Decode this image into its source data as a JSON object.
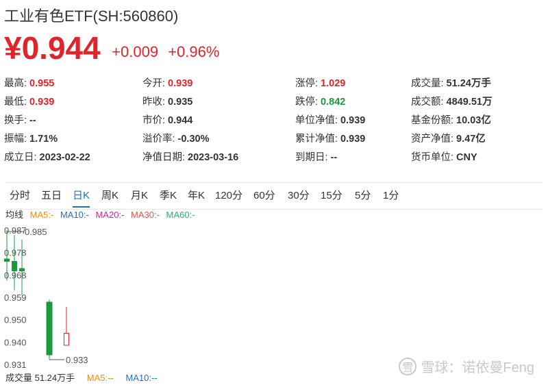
{
  "header": {
    "title": "工业有色ETF(SH:560860)",
    "price": "¥0.944",
    "change": "+0.009",
    "change_pct": "+0.96%"
  },
  "quote": {
    "rows": [
      [
        {
          "label": "最高:",
          "value": "0.955",
          "tone": "up"
        },
        {
          "label": "今开:",
          "value": "0.939",
          "tone": "up"
        },
        {
          "label": "涨停:",
          "value": "1.029",
          "tone": "up"
        },
        {
          "label": "成交量:",
          "value": "51.24万手",
          "tone": ""
        }
      ],
      [
        {
          "label": "最低:",
          "value": "0.939",
          "tone": "up"
        },
        {
          "label": "昨收:",
          "value": "0.935",
          "tone": ""
        },
        {
          "label": "跌停:",
          "value": "0.842",
          "tone": "down"
        },
        {
          "label": "成交额:",
          "value": "4849.51万",
          "tone": ""
        }
      ],
      [
        {
          "label": "换手:",
          "value": "--",
          "tone": ""
        },
        {
          "label": "市价:",
          "value": "0.944",
          "tone": ""
        },
        {
          "label": "单位净值:",
          "value": "0.939",
          "tone": ""
        },
        {
          "label": "基金份额:",
          "value": "10.03亿",
          "tone": ""
        }
      ],
      [
        {
          "label": "振幅:",
          "value": "1.71%",
          "tone": ""
        },
        {
          "label": "溢价率:",
          "value": "-0.30%",
          "tone": ""
        },
        {
          "label": "累计净值:",
          "value": "0.939",
          "tone": ""
        },
        {
          "label": "资产净值:",
          "value": "9.47亿",
          "tone": ""
        }
      ],
      [
        {
          "label": "成立日:",
          "value": "2023-02-22",
          "tone": ""
        },
        {
          "label": "净值日期:",
          "value": "2023-03-16",
          "tone": ""
        },
        {
          "label": "到期日:",
          "value": "--",
          "tone": ""
        },
        {
          "label": "货币单位:",
          "value": "CNY",
          "tone": ""
        }
      ]
    ]
  },
  "tabs": [
    {
      "label": "分时",
      "active": false
    },
    {
      "label": "五日",
      "active": false
    },
    {
      "label": "日K",
      "active": true
    },
    {
      "label": "周K",
      "active": false
    },
    {
      "label": "月K",
      "active": false
    },
    {
      "label": "季K",
      "active": false
    },
    {
      "label": "年K",
      "active": false
    },
    {
      "label": "120分",
      "active": false
    },
    {
      "label": "60分",
      "active": false
    },
    {
      "label": "30分",
      "active": false
    },
    {
      "label": "15分",
      "active": false
    },
    {
      "label": "5分",
      "active": false
    },
    {
      "label": "1分",
      "active": false
    }
  ],
  "ma_line": {
    "label": "均线",
    "ma5": "MA5:-",
    "ma10": "MA10:-",
    "ma20": "MA20:-",
    "ma30": "MA30:-",
    "ma60": "MA60:-"
  },
  "volume_line": {
    "label": "成交量 51.24万手",
    "ma5": "MA5:--",
    "ma10": "MA10:--"
  },
  "watermark": {
    "logo": "雪",
    "text": "雪球：诺依曼Feng"
  },
  "colors": {
    "up": "#e0242a",
    "down": "#1a9a3c",
    "active_tab": "#1f6fd1"
  },
  "chart_data": {
    "type": "candlestick",
    "y_ticks": [
      "0.987",
      "0.978",
      "0.968",
      "0.959",
      "0.950",
      "0.940",
      "0.931"
    ],
    "ylim": [
      0.931,
      0.987
    ],
    "high_label": "0.985",
    "low_label": "0.933",
    "candles": [
      {
        "open": 0.975,
        "close": 0.974,
        "high": 0.987,
        "low": 0.966,
        "dir": "down"
      },
      {
        "open": 0.974,
        "close": 0.97,
        "high": 0.985,
        "low": 0.962,
        "dir": "down"
      },
      {
        "open": 0.971,
        "close": 0.97,
        "high": 0.983,
        "low": 0.96,
        "dir": "down"
      },
      {
        "open": 0.957,
        "close": 0.935,
        "high": 0.958,
        "low": 0.933,
        "dir": "down"
      },
      {
        "open": 0.939,
        "close": 0.944,
        "high": 0.955,
        "low": 0.939,
        "dir": "up"
      }
    ]
  }
}
